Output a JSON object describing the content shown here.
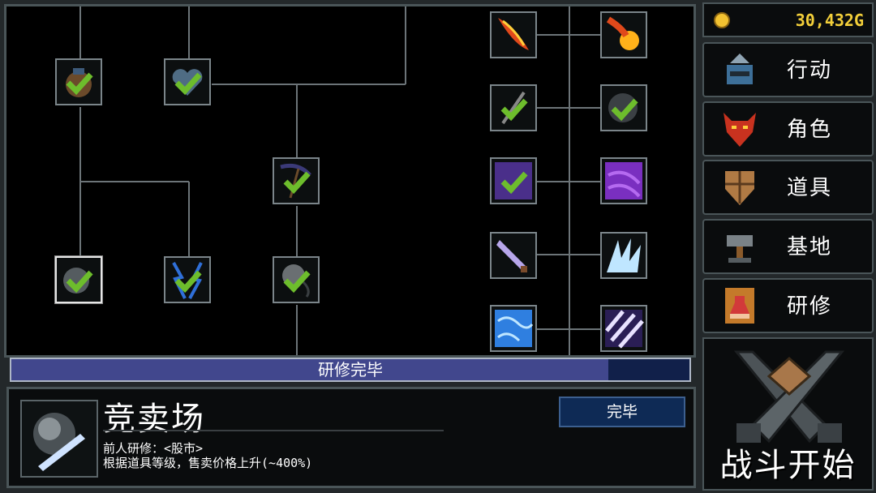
{
  "progress": {
    "label": "研修完毕",
    "fraction": 0.88
  },
  "detail": {
    "title": "竞卖场",
    "button_label": "完毕",
    "prerequisite": "前人研修：<股市>",
    "description": "根据道具等级，售卖价格上升(~400%)"
  },
  "gold": {
    "amount": "30,432G"
  },
  "menu": {
    "action": "行动",
    "character": "角色",
    "items": "道具",
    "base": "基地",
    "research": "研修"
  },
  "battle": {
    "label": "战斗开始"
  },
  "colors": {
    "check": "#6dbd2c",
    "gold": "#f3cf3a",
    "progress_fill": "#41478d",
    "node_border": "#7b858a"
  }
}
